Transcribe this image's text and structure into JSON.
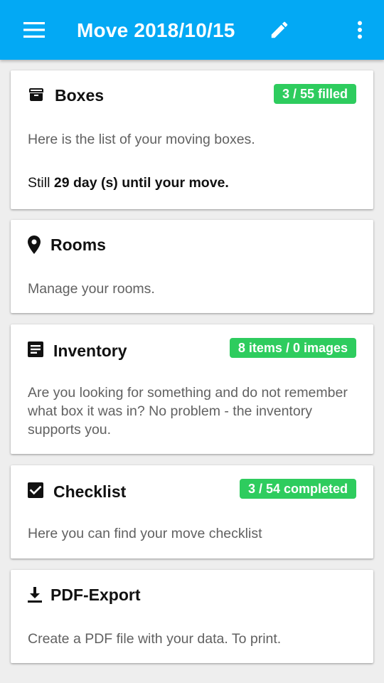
{
  "app_bar": {
    "title": "Move 2018/10/15",
    "menu_icon": "menu-icon",
    "edit_icon": "pencil-icon",
    "overflow_icon": "more-vertical-icon",
    "color": "#03a9f4"
  },
  "accent": {
    "badge_color": "#2ecc5e"
  },
  "cards": {
    "boxes": {
      "icon": "archive-box-icon",
      "title": "Boxes",
      "badge": "3 / 55 filled",
      "description": "Here is the list of your moving boxes.",
      "countdown_prefix": "Still",
      "countdown_bold": "29 day (s) until your move."
    },
    "rooms": {
      "icon": "location-pin-icon",
      "title": "Rooms",
      "description": "Manage your rooms."
    },
    "inventory": {
      "icon": "document-list-icon",
      "title": "Inventory",
      "badge": "8 items / 0 images",
      "description": "Are you looking for something and do not remember what box it was in? No problem - the inventory supports you."
    },
    "checklist": {
      "icon": "checkbox-checked-icon",
      "title": "Checklist",
      "badge": "3 / 54 completed",
      "description": "Here you can find your move checklist"
    },
    "pdf_export": {
      "icon": "download-icon",
      "title": "PDF-Export",
      "description": "Create a PDF file with your data. To print."
    }
  }
}
